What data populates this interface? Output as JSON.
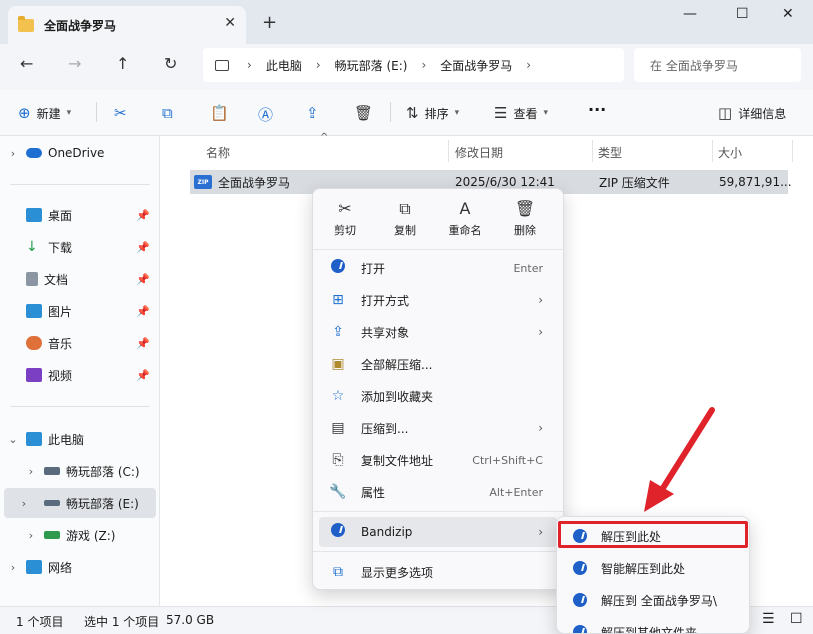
{
  "window": {
    "tab_title": "全面战争罗马",
    "close_tab": "✕",
    "new_tab": "+",
    "minimize": "—",
    "maximize": "☐",
    "close": "✕"
  },
  "nav": {
    "back": "←",
    "forward": "→",
    "up": "↑",
    "refresh": "↻",
    "breadcrumb": [
      "此电脑",
      "畅玩部落 (E:)",
      "全面战争罗马"
    ],
    "search_placeholder": "在 全面战争罗马"
  },
  "toolbar": {
    "new_label": "新建",
    "sort_label": "排序",
    "view_label": "查看",
    "more": "···",
    "details_label": "详细信息"
  },
  "sidebar": {
    "items": [
      {
        "label": "OneDrive"
      },
      {
        "label": "桌面"
      },
      {
        "label": "下载"
      },
      {
        "label": "文档"
      },
      {
        "label": "图片"
      },
      {
        "label": "音乐"
      },
      {
        "label": "视频"
      },
      {
        "label": "此电脑"
      },
      {
        "label": "畅玩部落 (C:)"
      },
      {
        "label": "畅玩部落 (E:)"
      },
      {
        "label": "游戏 (Z:)"
      },
      {
        "label": "网络"
      }
    ]
  },
  "filelist": {
    "columns": [
      "名称",
      "修改日期",
      "类型",
      "大小"
    ],
    "rows": [
      {
        "name": "全面战争罗马",
        "date": "2025/6/30 12:41",
        "type": "ZIP 压缩文件",
        "size": "59,871,91..."
      }
    ]
  },
  "status": {
    "count": "1 个项目",
    "selected": "选中 1 个项目",
    "size": "57.0 GB"
  },
  "context_menu": {
    "top_actions": [
      {
        "label": "剪切",
        "icon": "✂"
      },
      {
        "label": "复制",
        "icon": "⧉"
      },
      {
        "label": "重命名",
        "icon": "A"
      },
      {
        "label": "删除",
        "icon": "🗑"
      }
    ],
    "items": [
      {
        "label": "打开",
        "shortcut": "Enter"
      },
      {
        "label": "打开方式",
        "shortcut": ""
      },
      {
        "label": "共享对象",
        "shortcut": ""
      },
      {
        "label": "全部解压缩...",
        "shortcut": ""
      },
      {
        "label": "添加到收藏夹",
        "shortcut": ""
      },
      {
        "label": "压缩到...",
        "shortcut": ""
      },
      {
        "label": "复制文件地址",
        "shortcut": "Ctrl+Shift+C"
      },
      {
        "label": "属性",
        "shortcut": "Alt+Enter"
      },
      {
        "label": "Bandizip",
        "shortcut": ""
      },
      {
        "label": "显示更多选项",
        "shortcut": ""
      }
    ]
  },
  "submenu": {
    "items": [
      {
        "label": "解压到此处"
      },
      {
        "label": "智能解压到此处"
      },
      {
        "label": "解压到 全面战争罗马\\"
      },
      {
        "label": "解压到其他文件夹"
      }
    ]
  },
  "colors": {
    "accent": "#1e6fd1",
    "highlight_box": "#e0222a",
    "arrow": "#e0222a"
  }
}
